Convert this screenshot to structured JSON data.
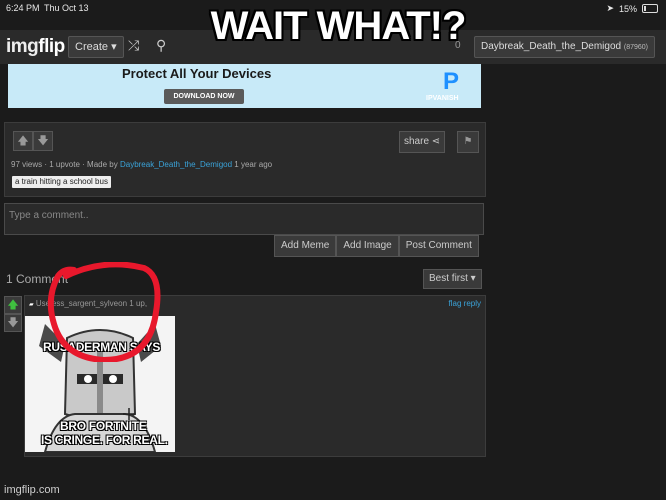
{
  "meme": {
    "caption": "WAIT WHAT!?",
    "watermark": "imgflip.com"
  },
  "statusbar": {
    "time": "6:24 PM",
    "date": "Thu Oct 13",
    "battery": "15%"
  },
  "navbar": {
    "logo_a": "img",
    "logo_b": "flip",
    "create_label": "Create ▾",
    "notif_count": "0",
    "username": "Daybreak_Death_the_Demigod",
    "user_points": "(87960)"
  },
  "ad": {
    "headline": "Protect All Your Devices",
    "cta": "DOWNLOAD NOW",
    "brand_mark": "P",
    "brand": "IPVANISH"
  },
  "post": {
    "views": "97 views",
    "upvotes": "1 upvote",
    "made_by": "Made by",
    "author": "Daybreak_Death_the_Demigod",
    "age": "1 year ago",
    "tag": "a train hitting a school bus",
    "share_label": "share"
  },
  "comment_form": {
    "placeholder": "Type a comment..",
    "add_meme": "Add Meme",
    "add_image": "Add Image",
    "post_comment": "Post Comment"
  },
  "comments": {
    "count_label": "1 Comment",
    "sort_label": "Best first ▾",
    "items": [
      {
        "username": "Useless_sargent_sylveon",
        "points": "1 up,",
        "flag": "flag",
        "reply": "reply",
        "meme_top": "RUSADERMAN SAYS",
        "meme_bottom_1": "BRO FORTNITE",
        "meme_bottom_2": "IS CRINGE. FOR REAL."
      }
    ]
  },
  "colors": {
    "accent_link": "#3aa3d9",
    "upvote_green": "#3fbf3f",
    "annotation_red": "#e8182c"
  }
}
